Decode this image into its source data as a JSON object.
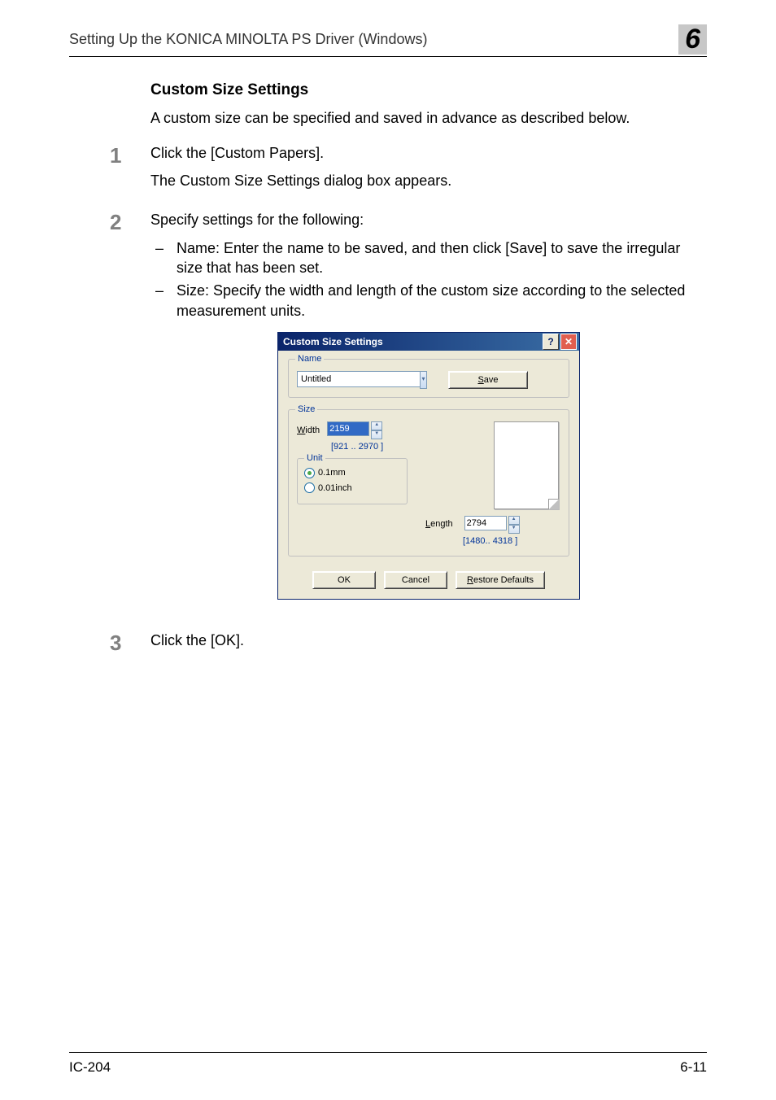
{
  "header": {
    "title": "Setting Up the KONICA MINOLTA PS Driver (Windows)",
    "chapter": "6"
  },
  "section": {
    "title": "Custom Size Settings",
    "intro": "A custom size can be specified and saved in advance as described below."
  },
  "steps": [
    {
      "num": "1",
      "lines": [
        "Click the [Custom Papers].",
        "The Custom Size Settings dialog box appears."
      ]
    },
    {
      "num": "2",
      "lines": [
        "Specify settings for the following:"
      ],
      "bullets": [
        "Name: Enter the name to be saved, and then click [Save] to save the irregular size that has been set.",
        "Size: Specify the width and length of the custom size according to the selected measurement units."
      ]
    },
    {
      "num": "3",
      "lines": [
        "Click the [OK]."
      ]
    }
  ],
  "dialog": {
    "title": "Custom Size Settings",
    "name_group": "Name",
    "name_value": "Untitled",
    "save_label": "Save",
    "size_group": "Size",
    "width_label": "Width",
    "width_value": "2159",
    "width_range": "[921   .. 2970  ]",
    "length_label": "Length",
    "length_value": "2794",
    "length_range": "[1480.. 4318  ]",
    "unit_group": "Unit",
    "unit_mm": "0.1mm",
    "unit_inch": "0.01inch",
    "ok_label": "OK",
    "cancel_label": "Cancel",
    "restore_label": "Restore Defaults"
  },
  "footer": {
    "left": "IC-204",
    "right": "6-11"
  }
}
